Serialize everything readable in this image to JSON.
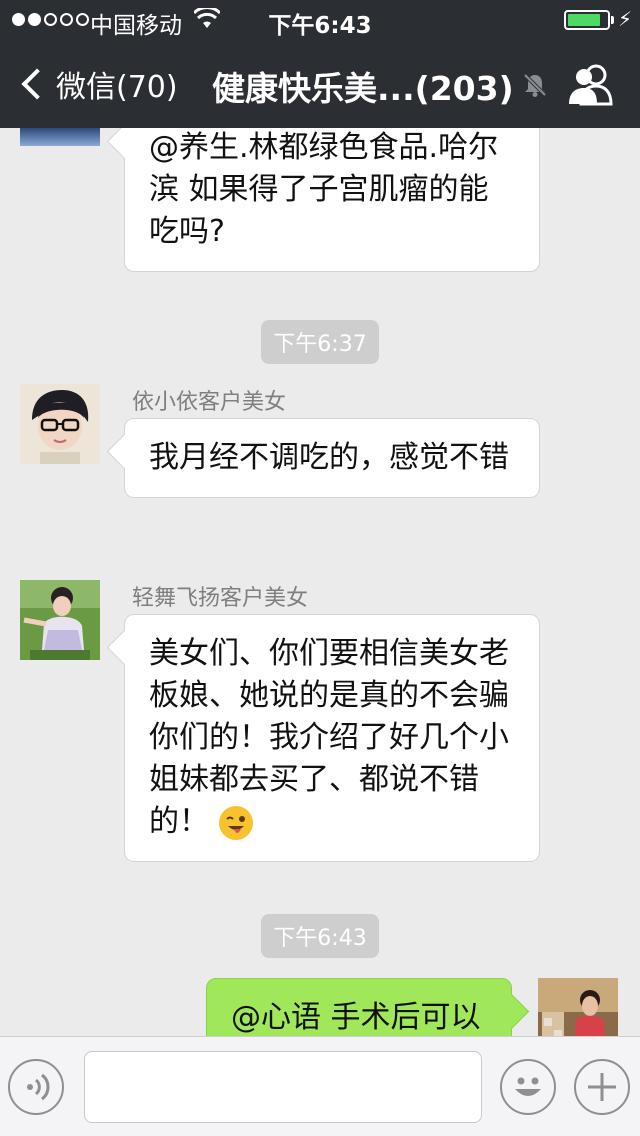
{
  "status": {
    "carrier": "中国移动",
    "time": "下午6:43",
    "battery_level": 0.85,
    "signal_bars_filled": 2,
    "signal_bars_total": 5
  },
  "nav": {
    "back_label": "微信(70)",
    "title": "健康快乐美...(203)"
  },
  "messages": [
    {
      "type": "incoming",
      "sender": "",
      "text": "@养生.林都绿色食品.哈尔滨 如果得了子宫肌瘤的能吃吗?"
    },
    {
      "type": "time",
      "text": "下午6:37"
    },
    {
      "type": "incoming",
      "sender": "依小依客户美女",
      "text": "我月经不调吃的，感觉不错"
    },
    {
      "type": "incoming",
      "sender": "轻舞飞扬客户美女",
      "text": "美女们、你们要相信美女老板娘、她说的是真的不会骗你们的！我介绍了好几个小姐妹都去买了、都说不错的！",
      "emoji": "winking-tongue-emoji"
    },
    {
      "type": "time",
      "text": "下午6:43"
    },
    {
      "type": "outgoing",
      "sender": "",
      "text": "@心语 手术后可以"
    }
  ],
  "input": {
    "value": "",
    "placeholder": ""
  },
  "colors": {
    "nav_bg": "#2b2e33",
    "chat_bg": "#ebebeb",
    "outgoing_bubble": "#a0e75a",
    "incoming_bubble": "#ffffff",
    "battery": "#4cd964"
  },
  "icons": {
    "back": "chevron-left-icon",
    "mute": "mute-bell-icon",
    "group": "group-members-icon",
    "voice": "voice-icon",
    "emoji": "emoji-face-icon",
    "plus": "plus-icon"
  }
}
